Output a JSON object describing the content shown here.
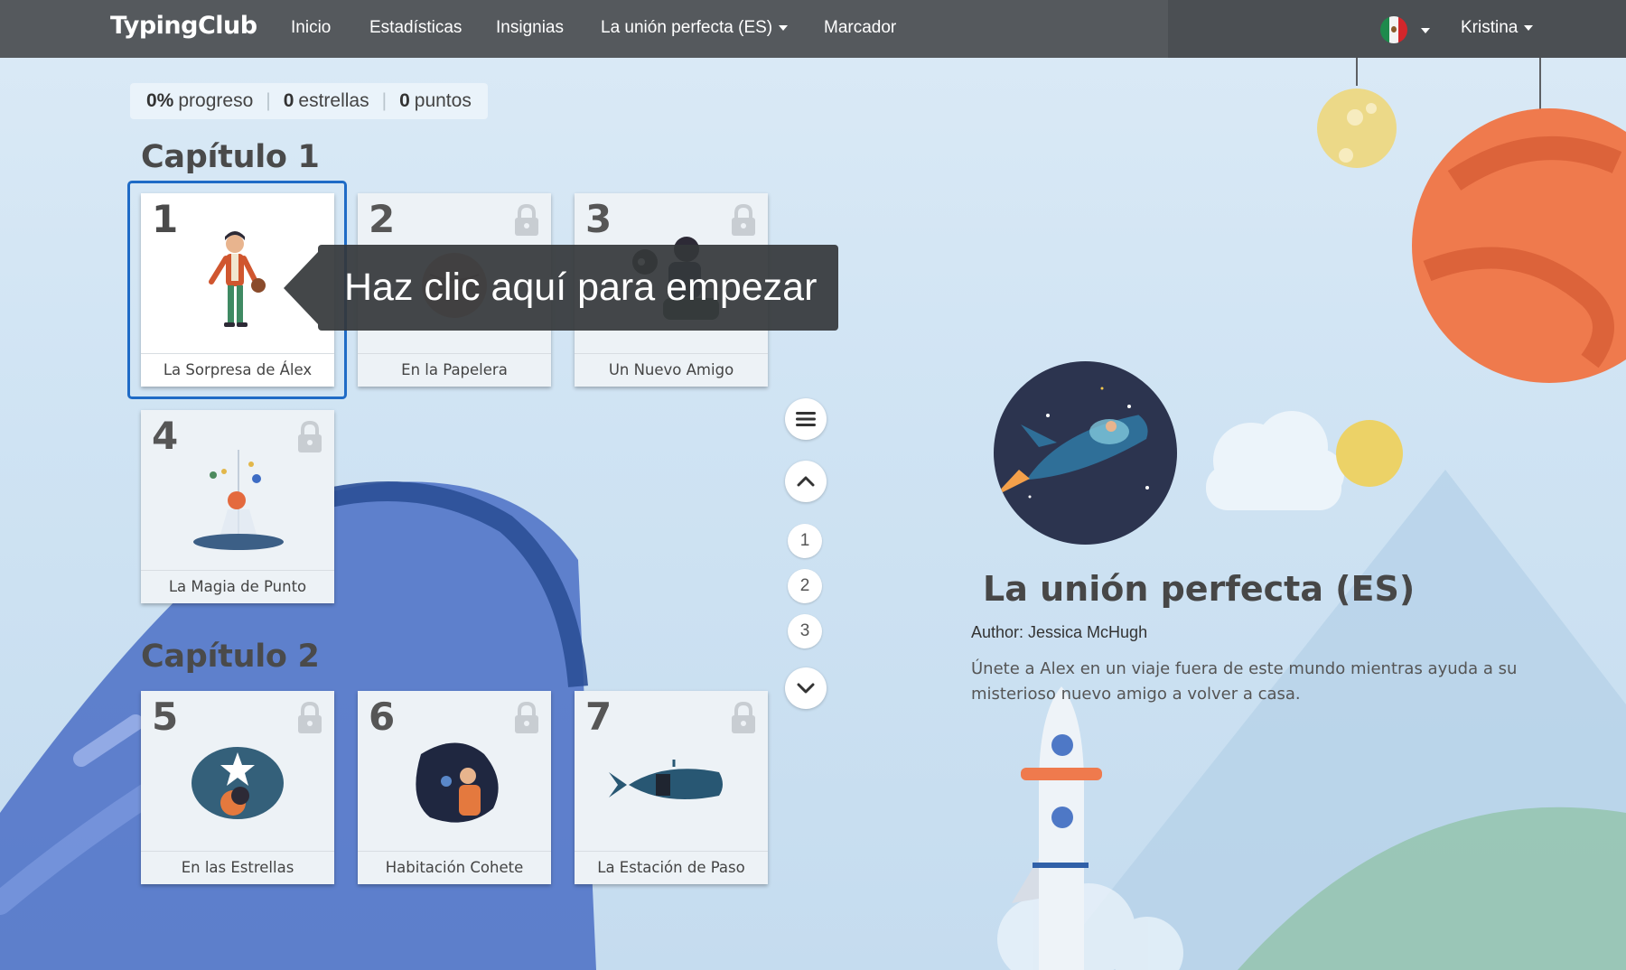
{
  "navbar": {
    "brand": "TypingClub",
    "links": [
      "Inicio",
      "Estadísticas",
      "Insignias",
      "La unión perfecta (ES)",
      "Marcador"
    ],
    "user": "Kristina",
    "language_flag": "mexico-flag-icon"
  },
  "stats": {
    "progress_value": "0%",
    "progress_label": "progreso",
    "stars_value": "0",
    "stars_label": "estrellas",
    "points_value": "0",
    "points_label": "puntos"
  },
  "chapters": [
    {
      "title": "Capítulo 1",
      "lessons": [
        {
          "num": "1",
          "label": "La Sorpresa de Álex",
          "locked": false,
          "icon": "boy-with-glove-illustration"
        },
        {
          "num": "2",
          "label": "En la Papelera",
          "locked": true,
          "icon": "ball-illustration"
        },
        {
          "num": "3",
          "label": "Un Nuevo Amigo",
          "locked": true,
          "icon": "boy-with-robot-illustration"
        },
        {
          "num": "4",
          "label": "La Magia de Punto",
          "locked": true,
          "icon": "mobile-planets-illustration"
        }
      ]
    },
    {
      "title": "Capítulo 2",
      "lessons": [
        {
          "num": "5",
          "label": "En las Estrellas",
          "locked": true,
          "icon": "stargazing-illustration"
        },
        {
          "num": "6",
          "label": "Habitación Cohete",
          "locked": true,
          "icon": "space-room-illustration"
        },
        {
          "num": "7",
          "label": "La Estación de Paso",
          "locked": true,
          "icon": "spaceship-illustration"
        }
      ]
    }
  ],
  "tooltip": "Haz clic aquí para empezar",
  "side_nav": {
    "pages": [
      "1",
      "2",
      "3"
    ]
  },
  "course": {
    "title": "La unión perfecta (ES)",
    "author": "Author: Jessica McHugh",
    "description": "Únete a Alex en un viaje fuera de este mundo mientras ayuda a su misterioso nuevo amigo a volver a casa."
  },
  "colors": {
    "navbar": "#55595d",
    "selected_outline": "#1f6bc6",
    "planet": "#ef7a4d"
  }
}
